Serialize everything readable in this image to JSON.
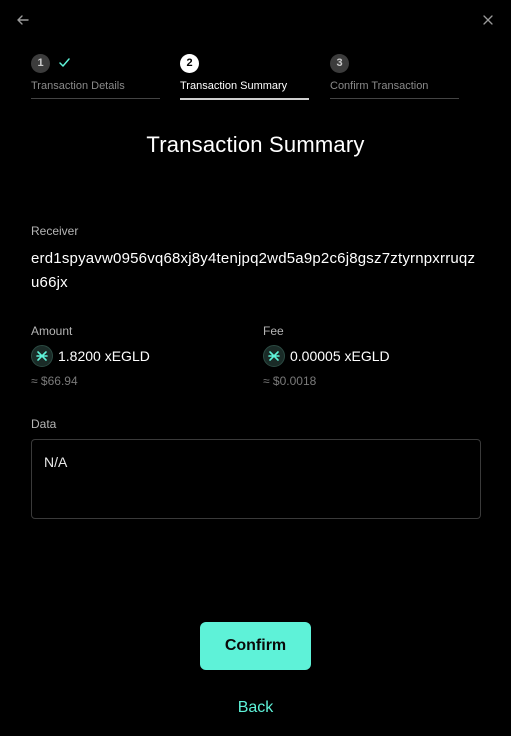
{
  "header": {
    "back_icon": "arrow-left-icon",
    "close_icon": "close-icon"
  },
  "steps": [
    {
      "number": "1",
      "label": "Transaction Details",
      "state": "done"
    },
    {
      "number": "2",
      "label": "Transaction Summary",
      "state": "active"
    },
    {
      "number": "3",
      "label": "Confirm Transaction",
      "state": "todo"
    }
  ],
  "title": "Transaction Summary",
  "receiver": {
    "label": "Receiver",
    "value": "erd1spyavw0956vq68xj8y4tenjpq2wd5a9p2c6j8gsz7ztyrnpxrruqzu66jx"
  },
  "amount": {
    "label": "Amount",
    "value": "1.8200 xEGLD",
    "usd": "≈ $66.94"
  },
  "fee": {
    "label": "Fee",
    "value": "0.00005 xEGLD",
    "usd": "≈ $0.0018"
  },
  "data": {
    "label": "Data",
    "value": "N/A"
  },
  "actions": {
    "confirm_label": "Confirm",
    "back_label": "Back"
  },
  "colors": {
    "accent": "#5ef2d8",
    "background": "#000000"
  }
}
